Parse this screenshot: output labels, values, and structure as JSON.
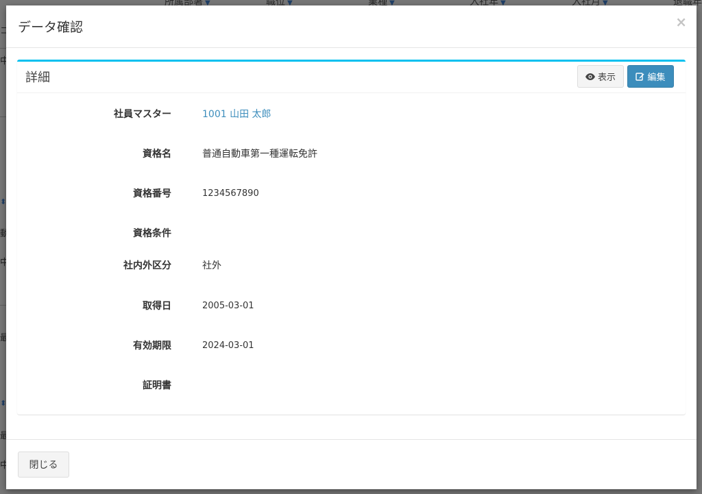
{
  "background": {
    "columns": [
      "所属部署",
      "職位",
      "業種",
      "入社年",
      "入社月",
      "退職年"
    ],
    "left_fragments": [
      "コ",
      "中",
      "動",
      "中",
      "最",
      "最",
      "中"
    ]
  },
  "modal": {
    "title": "データ確認",
    "close_symbol": "×"
  },
  "box": {
    "title": "詳細",
    "view_label": "表示",
    "edit_label": "編集"
  },
  "fields": [
    {
      "label": "社員マスター",
      "value": "1001 山田 太郎"
    },
    {
      "label": "資格名",
      "value": "普通自動車第一種運転免許"
    },
    {
      "label": "資格番号",
      "value": "1234567890"
    },
    {
      "label": "資格条件",
      "value": ""
    },
    {
      "label": "社内外区分",
      "value": "社外"
    },
    {
      "label": "取得日",
      "value": "2005-03-01"
    },
    {
      "label": "有効期限",
      "value": "2024-03-01"
    },
    {
      "label": "証明書",
      "value": ""
    }
  ],
  "footer": {
    "close_label": "閉じる"
  },
  "colors": {
    "accent_top": "#00c0ef",
    "primary": "#3c8dbc"
  }
}
